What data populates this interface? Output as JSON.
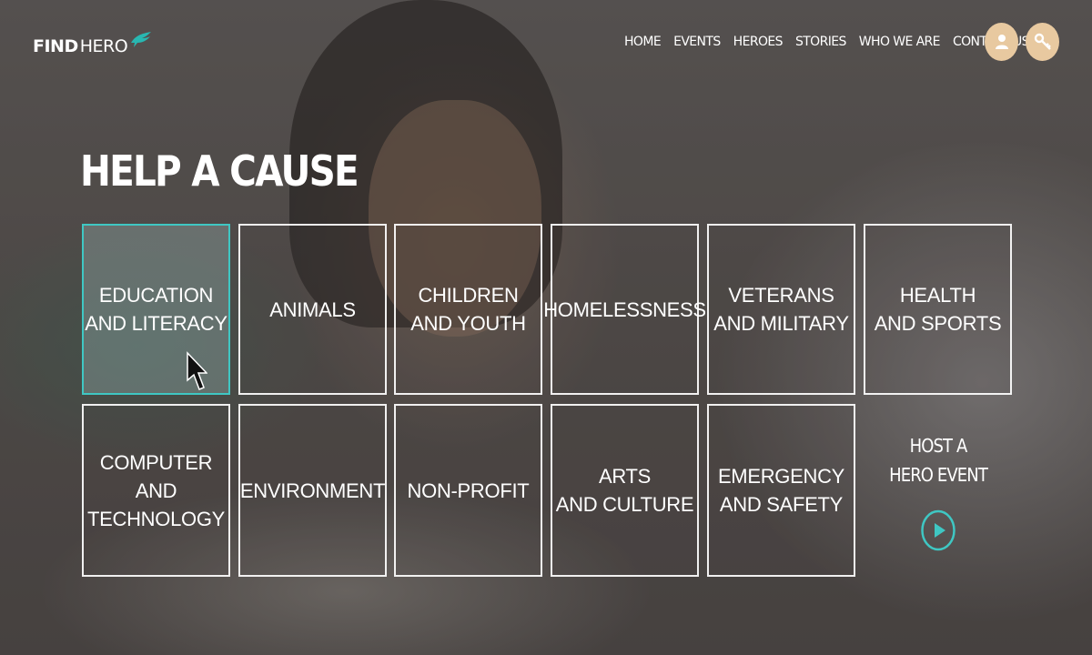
{
  "header": {
    "logo_find": "FIND",
    "logo_hero": "HERO",
    "nav": [
      "HOME",
      "EVENTS",
      "HEROES",
      "STORIES",
      "WHO WE ARE",
      "CONTACT US"
    ]
  },
  "main": {
    "title": "HELP A CAUSE",
    "causes": [
      "EDUCATION\nAND LITERACY",
      "ANIMALS",
      "CHILDREN\nAND YOUTH",
      "HOMELESSNESS",
      "VETERANS\nAND MILITARY",
      "HEALTH\nAND SPORTS",
      "COMPUTER AND\nTECHNOLOGY",
      "ENVIRONMENT",
      "NON-PROFIT",
      "ARTS\nAND CULTURE",
      "EMERGENCY\nAND SAFETY"
    ],
    "host_event": "HOST A\nHERO EVENT"
  },
  "icons": {
    "logo": "bird-icon",
    "user": "user-icon",
    "key": "key-icon",
    "play": "play-icon",
    "cursor": "mouse-cursor-icon"
  },
  "colors": {
    "accent": "#3fc7c3",
    "icon_button": "#e8c9a0",
    "logo_bird": "#28b7b1"
  }
}
